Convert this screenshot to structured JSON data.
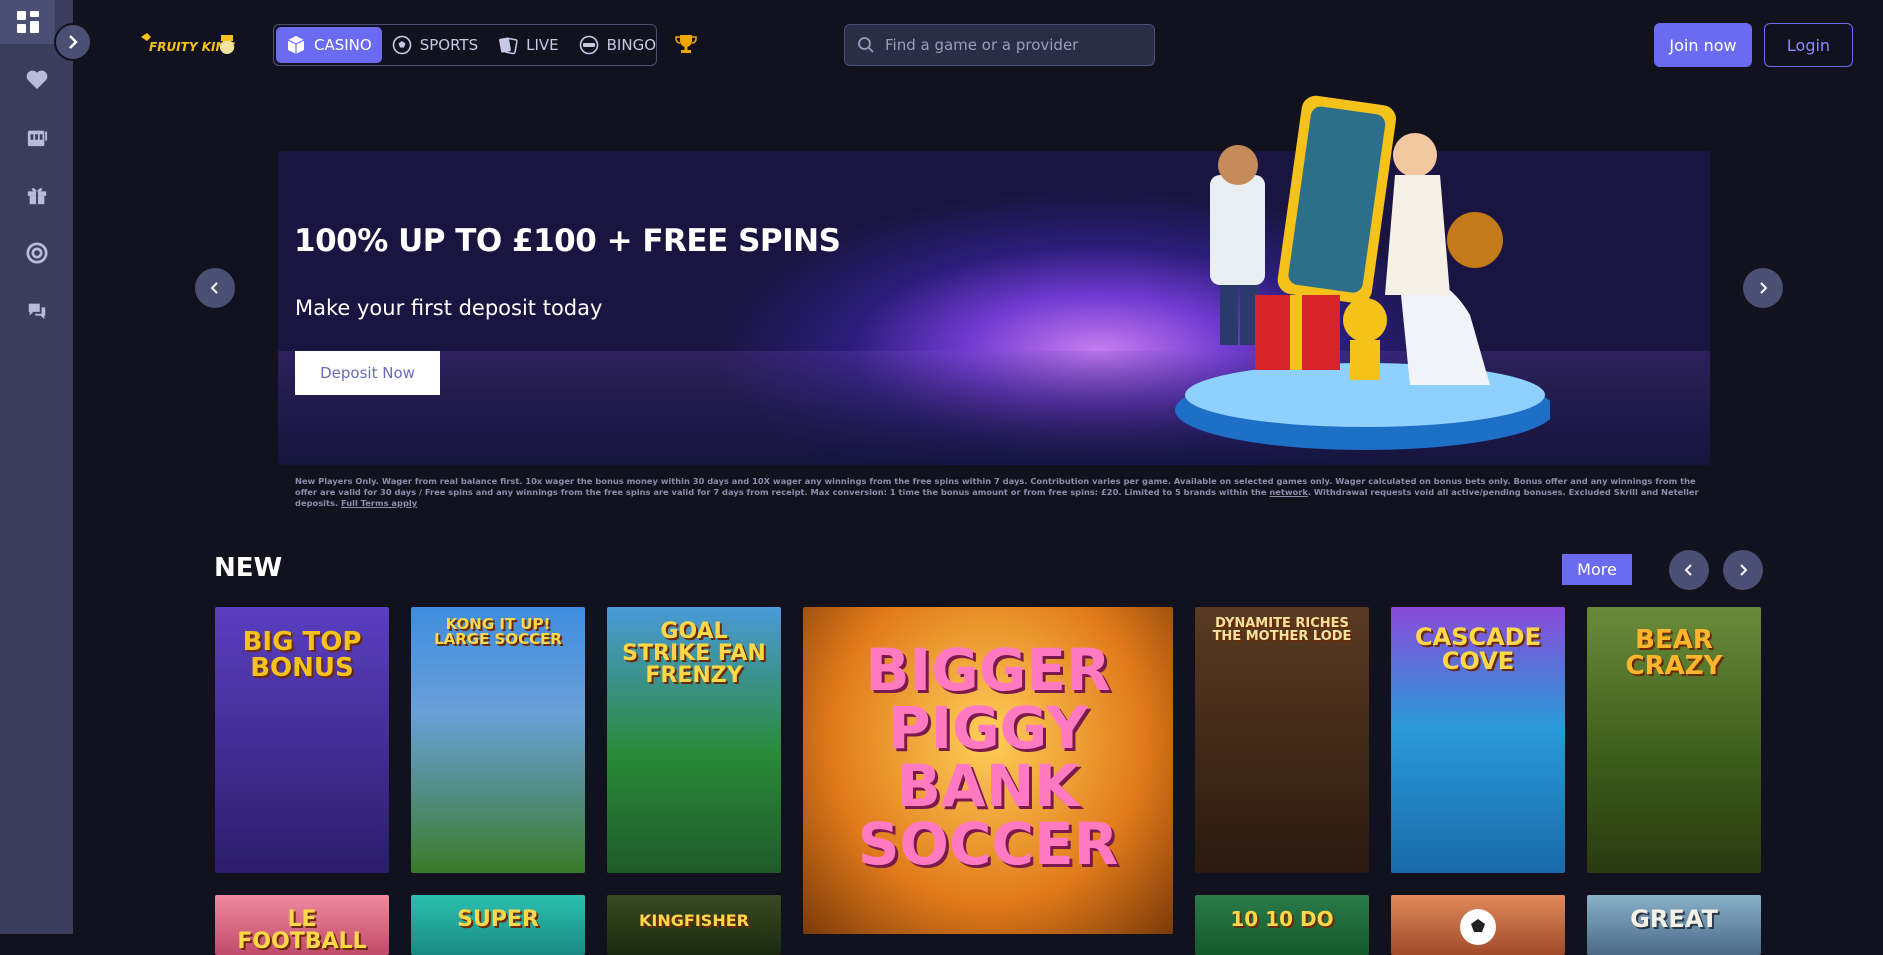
{
  "brand": {
    "logo_text": "FRUITY KING"
  },
  "nav": {
    "items": [
      {
        "label": "CASINO",
        "icon": "cube-icon",
        "active": true
      },
      {
        "label": "SPORTS",
        "icon": "soccer-ball-icon",
        "active": false
      },
      {
        "label": "LIVE",
        "icon": "cards-icon",
        "active": false
      },
      {
        "label": "BINGO",
        "icon": "bingo-ball-icon",
        "active": false
      }
    ]
  },
  "search": {
    "placeholder": "Find a game or a provider"
  },
  "auth": {
    "join_label": "Join now",
    "login_label": "Login"
  },
  "sidebar": {
    "items": [
      "dashboard-icon",
      "heart-icon",
      "slot-machine-icon",
      "gift-icon",
      "lifebuoy-icon",
      "chat-icon"
    ]
  },
  "hero": {
    "title": "100% UP TO £100 + FREE SPINS",
    "subtitle": "Make your first deposit today",
    "cta_label": "Deposit Now"
  },
  "terms": {
    "text_1": "New Players Only. Wager from real balance first. 10x wager the bonus money within 30 days and 10X wager any winnings from the free spins within 7 days. Contribution varies per game. Available on selected games only. Wager calculated on bonus bets only. Bonus offer and any winnings from the offer are valid for 30 days / Free spins and any winnings from the free spins are valid for 7 days from receipt. Max conversion: 1 time the bonus amount or from free spins: £20. Limited to 5 brands within the ",
    "network_link": "network",
    "text_2": ". Withdrawal requests void all active/pending bonuses. Excluded Skrill and Neteller deposits. ",
    "full_terms_link": "Full Terms apply"
  },
  "new_section": {
    "title": "NEW",
    "more_label": "More",
    "games": [
      {
        "title": "BIG TOP BONUS",
        "bg": "#3b2a8c"
      },
      {
        "title": "KONG IT UP! LARGE SOCCER",
        "bg": "#2f6ec7"
      },
      {
        "title": "GOAL STRIKE FAN FRENZY",
        "bg": "#1f7a3a"
      },
      {
        "title": "BIGGER PIGGY BANK SOCCER",
        "bg": "#e08a1a"
      },
      {
        "title": "DYNAMITE RICHES THE MOTHER LODE",
        "bg": "#3a2416"
      },
      {
        "title": "CASCADE COVE",
        "bg": "#2a8fd1"
      },
      {
        "title": "BEAR CRAZY",
        "bg": "#3f5a2a"
      },
      {
        "title": "LE FOOTBALL",
        "bg": "#e06a8a"
      },
      {
        "title": "SUPER",
        "bg": "#1fa39a"
      },
      {
        "title": "KINGFISHER",
        "bg": "#2a3a1a"
      },
      {
        "title": "10 10 DO",
        "bg": "#1f6a3a"
      },
      {
        "title": "",
        "bg": "#d46a3a"
      },
      {
        "title": "GREAT",
        "bg": "#5a8aa8"
      }
    ]
  }
}
